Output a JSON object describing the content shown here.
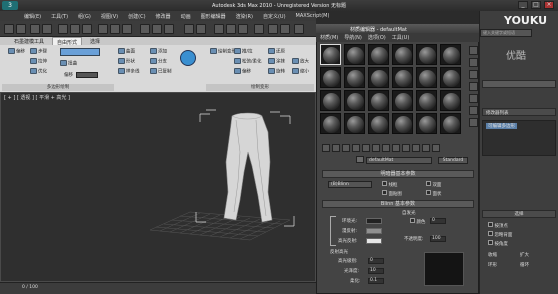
{
  "window": {
    "title": "Autodesk 3ds Max 2010 - Unregistered Version   无标题",
    "logo": "3"
  },
  "menubar": [
    "编辑(E)",
    "工具(T)",
    "组(G)",
    "视图(V)",
    "创建(C)",
    "修改器",
    "动画",
    "图形编辑器",
    "渲染(R)",
    "自定义(U)",
    "MAXScript(M)",
    "帮助(H)"
  ],
  "ribbon": {
    "tabs": [
      "石墨建模工具",
      "自由形式",
      "选择"
    ],
    "active_tab": "自由形式",
    "buttons_left": [
      "偏移",
      "步骤",
      "拉伸",
      "优化",
      "扭曲",
      "顶点",
      "偏移"
    ],
    "group1_label": "多边形绘制",
    "buttons_mid": [
      "曲面",
      "形状",
      "样条线",
      "添加",
      "分支",
      "已复制"
    ],
    "buttons_right": [
      "绘制变形",
      "推/拉",
      "松弛/柔化",
      "偏移",
      "还原",
      "涂抹",
      "旋转",
      "放大",
      "缩小"
    ],
    "group2_label": "绘制变形"
  },
  "viewport": {
    "label": "[ + ] [ 透视 ] [ 平滑 + 高光 ]",
    "frame": "0 / 100"
  },
  "material_editor": {
    "title": "材质编辑器 - defaultMat",
    "menu": [
      "材质(M)",
      "导航(N)",
      "选项(O)",
      "工具(U)"
    ],
    "material_name": "defaultMat",
    "material_type": "Standard",
    "rollout1": "明暗器基本参数",
    "shader": "(B)Blinn",
    "opts": [
      "线框",
      "双面",
      "面贴图",
      "面状"
    ],
    "rollout2": "Blinn 基本参数",
    "self_illum_label": "自发光",
    "color_label": "颜色",
    "color_value": "0",
    "ambient": "环境光:",
    "diffuse": "漫反射:",
    "specular": "高光反射:",
    "opacity_label": "不透明度:",
    "opacity_value": "100",
    "spec_label": "反射高光",
    "spec_level": "高光级别:",
    "spec_level_value": "0",
    "gloss": "光泽度:",
    "gloss_value": "10",
    "soften": "柔化:",
    "soften_value": "0.1"
  },
  "right_panel": {
    "brand": "YOUKU",
    "brand2": "优酷",
    "search_placeholder": "键入关键字或短语",
    "modifier_list": "修改器列表",
    "stack_item": "可编辑多边形",
    "section": "选择",
    "items": [
      "按顶点",
      "忽略背面",
      "按角度",
      "收缩",
      "扩大",
      "环形",
      "循环"
    ]
  },
  "colors": {
    "accent": "#1f6f74",
    "viewport_bg": "#2f2f2f",
    "ribbon_bg": "#d9d9d9"
  }
}
